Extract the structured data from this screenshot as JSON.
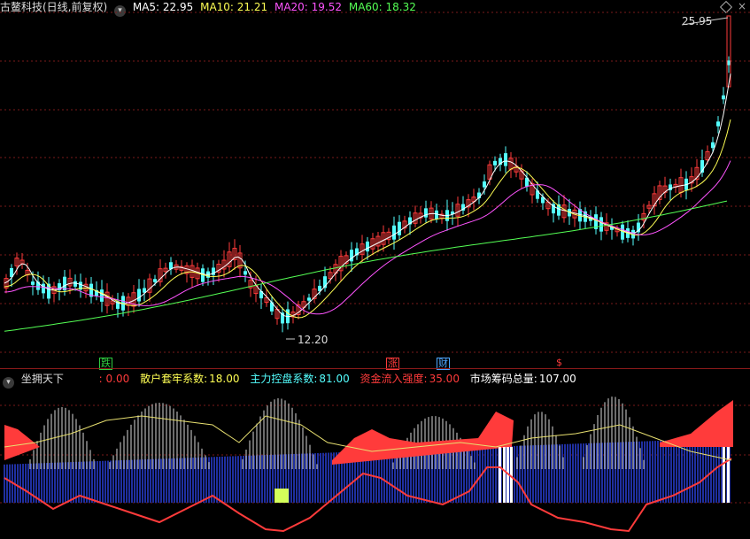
{
  "top": {
    "title": "古鳌科技(日线,前复权)",
    "ma5": "MA5: 22.95",
    "ma10": "MA10: 21.21",
    "ma20": "MA20: 19.52",
    "ma60": "MA60: 18.32",
    "high_label": "25.95",
    "low_label": "12.20"
  },
  "signals": [
    {
      "text": "跌",
      "color": "#2ecc40"
    },
    {
      "text": "涨",
      "color": "#ff3b3b"
    },
    {
      "text": "财",
      "color": "#4da6ff"
    },
    {
      "text": "$",
      "color": "#ff3b3b"
    }
  ],
  "indicator": {
    "name": "坐拥天下",
    "val0": ": 0.00",
    "retail_label": "散户套牢系数:",
    "retail_value": "18.00",
    "main_label": "主力控盘系数:",
    "main_value": "81.00",
    "inflow_label": "资金流入强度:",
    "inflow_value": "35.00",
    "total_label": "市场筹码总量:",
    "total_value": "107.00"
  },
  "colors": {
    "up": "#ff3b3b",
    "down": "#54ffff",
    "ma5": "#ffffff",
    "ma10": "#ffff54",
    "ma20": "#ff54ff",
    "ma60": "#54ff54"
  },
  "icons": [
    "chevron-down-icon",
    "diamond-icon"
  ]
}
